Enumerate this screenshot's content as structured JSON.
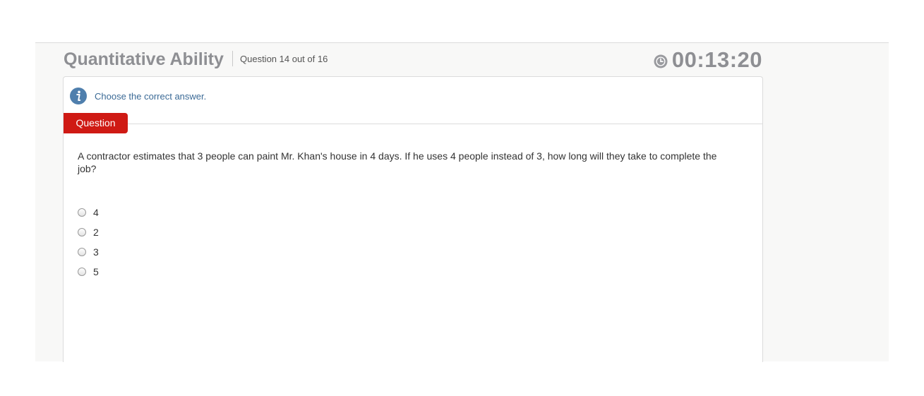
{
  "header": {
    "section_title": "Quantitative Ability",
    "question_counter": "Question 14 out of 16",
    "timer": "00:13:20",
    "timer_icon": "clock-icon"
  },
  "instruction": {
    "icon": "info-icon",
    "text": "Choose the correct answer."
  },
  "question": {
    "tab_label": "Question",
    "text": "A contractor estimates that 3 people can paint Mr. Khan's house in 4 days. If he uses 4 people instead of 3, how long will they take to complete the job?",
    "options": [
      {
        "label": "4",
        "selected": false
      },
      {
        "label": "2",
        "selected": false
      },
      {
        "label": "3",
        "selected": false
      },
      {
        "label": "5",
        "selected": false
      }
    ]
  },
  "colors": {
    "accent_red": "#cf1a14",
    "title_gray": "#8e8f93",
    "info_blue": "#3b6a96"
  }
}
